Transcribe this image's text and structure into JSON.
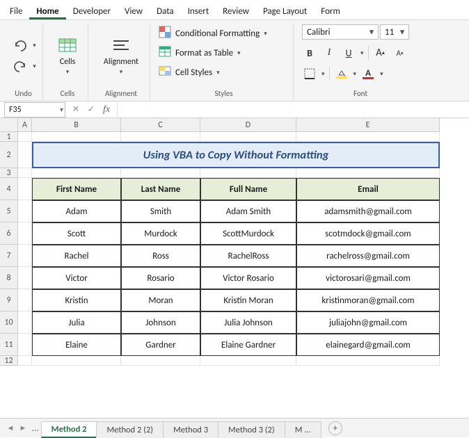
{
  "menu": {
    "file": "File",
    "home": "Home",
    "developer": "Developer",
    "view": "View",
    "data": "Data",
    "insert": "Insert",
    "review": "Review",
    "page_layout": "Page Layout",
    "form": "Form"
  },
  "ribbon": {
    "groups": {
      "undo": "Undo",
      "cells": "Cells",
      "alignment": "Alignment",
      "styles": "Styles",
      "font": "Font"
    },
    "cells_btn": "Cells",
    "alignment_btn": "Alignment",
    "cf": "Conditional Formatting",
    "fat": "Format as Table",
    "cs": "Cell Styles",
    "font_name": "Calibri",
    "font_size": "11",
    "bold": "B",
    "italic": "I",
    "underline": "U",
    "grow": "A",
    "shrink": "A"
  },
  "fbar": {
    "namebox": "F35",
    "formula": ""
  },
  "colheads": [
    "A",
    "B",
    "C",
    "D",
    "E"
  ],
  "rowheads": [
    "1",
    "2",
    "3",
    "4",
    "5",
    "6",
    "7",
    "8",
    "9",
    "10",
    "11",
    "12"
  ],
  "title": "Using VBA to Copy Without Formatting",
  "table": {
    "head": [
      "First Name",
      "Last Name",
      "Full Name",
      "Email"
    ],
    "rows": [
      [
        "Adam",
        "Smith",
        "Adam Smith",
        "adamsmith@gmail.com"
      ],
      [
        "Scott",
        "Murdock",
        "ScottMurdock",
        "scotmdock@gmail.com"
      ],
      [
        "Rachel",
        "Ross",
        "RachelRoss",
        "rachelross@gmail.com"
      ],
      [
        "Victor",
        "Rosario",
        "Victor Rosario",
        "victorosari@gmail.com"
      ],
      [
        "Kristin",
        "Moran",
        "Kristin Moran",
        "kristinmoran@gmail.com"
      ],
      [
        "Julia",
        "Johnson",
        "Julia Johnson",
        "juliajohn@gmail.com"
      ],
      [
        "Elaine",
        "Gardner",
        "Elaine Gardner",
        "elainegard@gmail.com"
      ]
    ]
  },
  "tabs": {
    "active": "Method 2",
    "t2": "Method 2 (2)",
    "t3": "Method 3",
    "t4": "Method 3 (2)",
    "t5": "M ..."
  }
}
